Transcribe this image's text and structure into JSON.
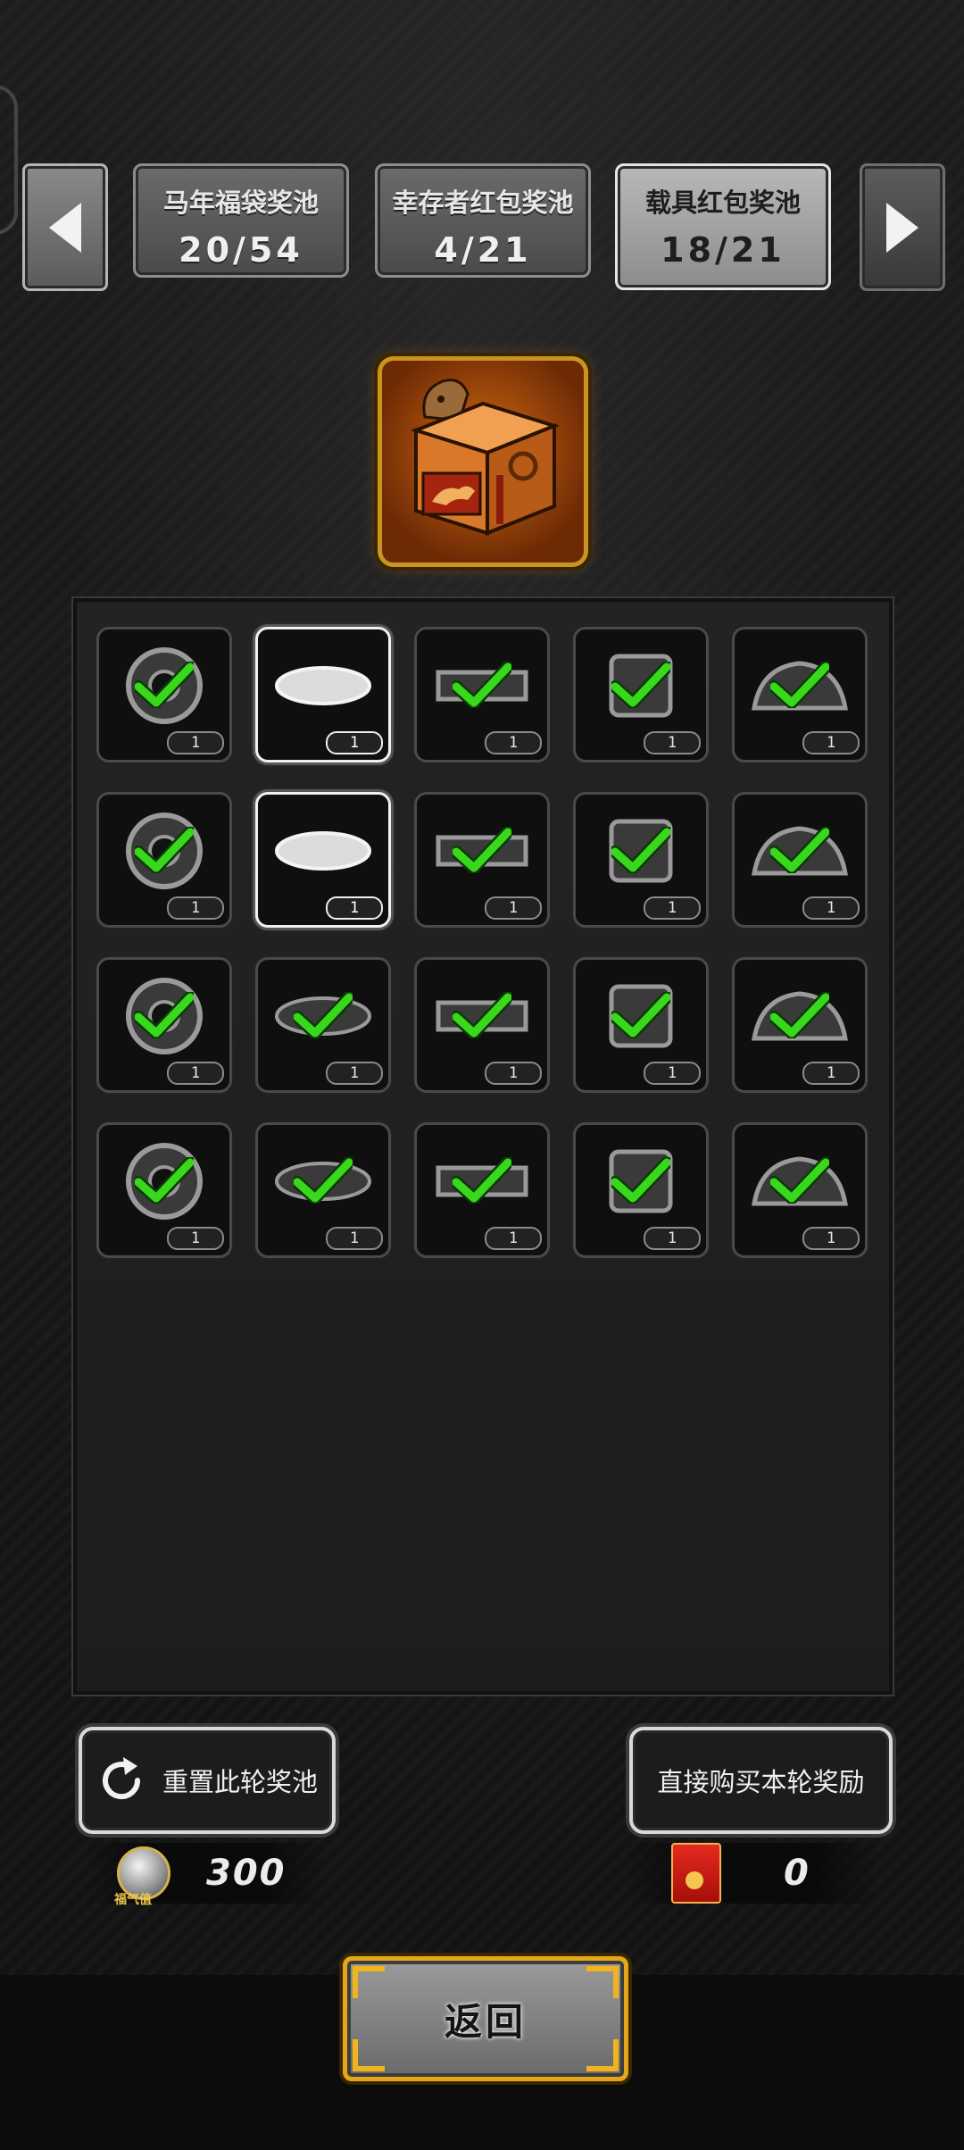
{
  "nav": {
    "prev_icon": "arrow-left-icon",
    "next_icon": "arrow-right-icon"
  },
  "pools": [
    {
      "name": "马年福袋奖池",
      "count": "20/54",
      "active": false
    },
    {
      "name": "幸存者红包奖池",
      "count": "4/21",
      "active": false
    },
    {
      "name": "载具红包奖池",
      "count": "18/21",
      "active": true
    }
  ],
  "chest": {
    "icon": "horse-treasure-chest-icon"
  },
  "items": [
    {
      "icon": "tire-icon",
      "qty": "1",
      "claimed": true
    },
    {
      "icon": "roof-box-icon",
      "qty": "1",
      "claimed": false
    },
    {
      "icon": "bumper-icon",
      "qty": "1",
      "claimed": true
    },
    {
      "icon": "engine-part-icon",
      "qty": "1",
      "claimed": true
    },
    {
      "icon": "car-body-icon",
      "qty": "1",
      "claimed": true
    },
    {
      "icon": "axle-part-icon",
      "qty": "1",
      "claimed": true
    },
    {
      "icon": "spoiler-icon",
      "qty": "1",
      "claimed": false
    },
    {
      "icon": "engine-block-icon",
      "qty": "1",
      "claimed": true
    },
    {
      "icon": "exhaust-pipe-icon",
      "qty": "1",
      "claimed": true
    },
    {
      "icon": "v8-engine-icon",
      "qty": "1",
      "claimed": true
    },
    {
      "icon": "cylinder-icon",
      "qty": "1",
      "claimed": true
    },
    {
      "icon": "toolbox-icon",
      "qty": "1",
      "claimed": true
    },
    {
      "icon": "toolbox-icon",
      "qty": "1",
      "claimed": true
    },
    {
      "icon": "gearbox-icon",
      "qty": "1",
      "claimed": true
    },
    {
      "icon": "driveshaft-icon",
      "qty": "1",
      "claimed": true
    },
    {
      "icon": "brake-assembly-icon",
      "qty": "1",
      "claimed": true
    },
    {
      "icon": "motor-icon",
      "qty": "1",
      "claimed": true
    },
    {
      "icon": "spiked-wheel-icon",
      "qty": "1",
      "claimed": true
    },
    {
      "icon": "suspension-icon",
      "qty": "1",
      "claimed": true
    },
    {
      "icon": "rim-icon",
      "qty": "1",
      "claimed": true
    }
  ],
  "actions": {
    "reset_label": "重置此轮奖池",
    "reset_icon": "refresh-icon",
    "buy_label": "直接购买本轮奖励"
  },
  "currency": {
    "luck_label": "福气值",
    "luck_value": "300",
    "redpacket_value": "0"
  },
  "back_label": "返回",
  "colors": {
    "claimed_check": "#39d81c",
    "frame_gold": "#e4a718"
  }
}
